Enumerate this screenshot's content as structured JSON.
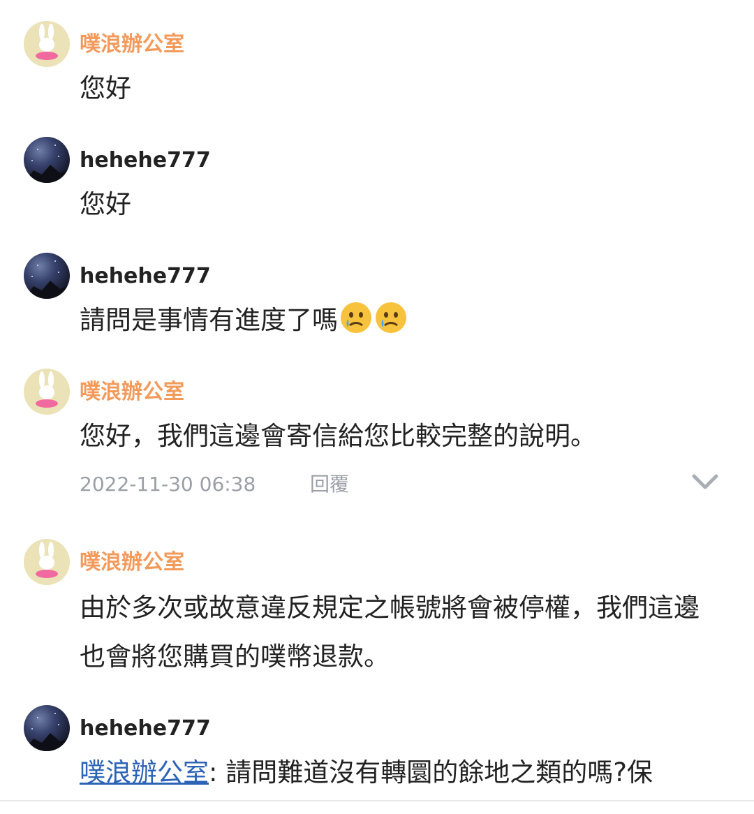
{
  "messages": [
    {
      "author": "噗浪辦公室",
      "type": "official",
      "text": "您好"
    },
    {
      "author": "hehehe777",
      "type": "user",
      "text": "您好"
    },
    {
      "author": "hehehe777",
      "type": "user",
      "text": "請問是事情有進度了嗎",
      "emojis": [
        "crying-face-icon",
        "crying-face-icon"
      ]
    },
    {
      "author": "噗浪辦公室",
      "type": "official",
      "text": "您好，我們這邊會寄信給您比較完整的說明。"
    },
    {
      "author": "噗浪辦公室",
      "type": "official",
      "text": "由於多次或故意違反規定之帳號將會被停權，我們這邊也會將您購買的噗幣退款。"
    },
    {
      "author": "hehehe777",
      "type": "user",
      "mention": "噗浪辦公室",
      "text": ": 請問難道沒有轉圜的餘地之類的嗎?保"
    }
  ],
  "footer": {
    "timestamp": "2022-11-30 06:38",
    "reply_label": "回覆"
  },
  "colors": {
    "official_name": "#f39a5b",
    "user_name": "#222222",
    "meta_text": "#9a9ea6",
    "mention_link": "#2b63b5"
  }
}
